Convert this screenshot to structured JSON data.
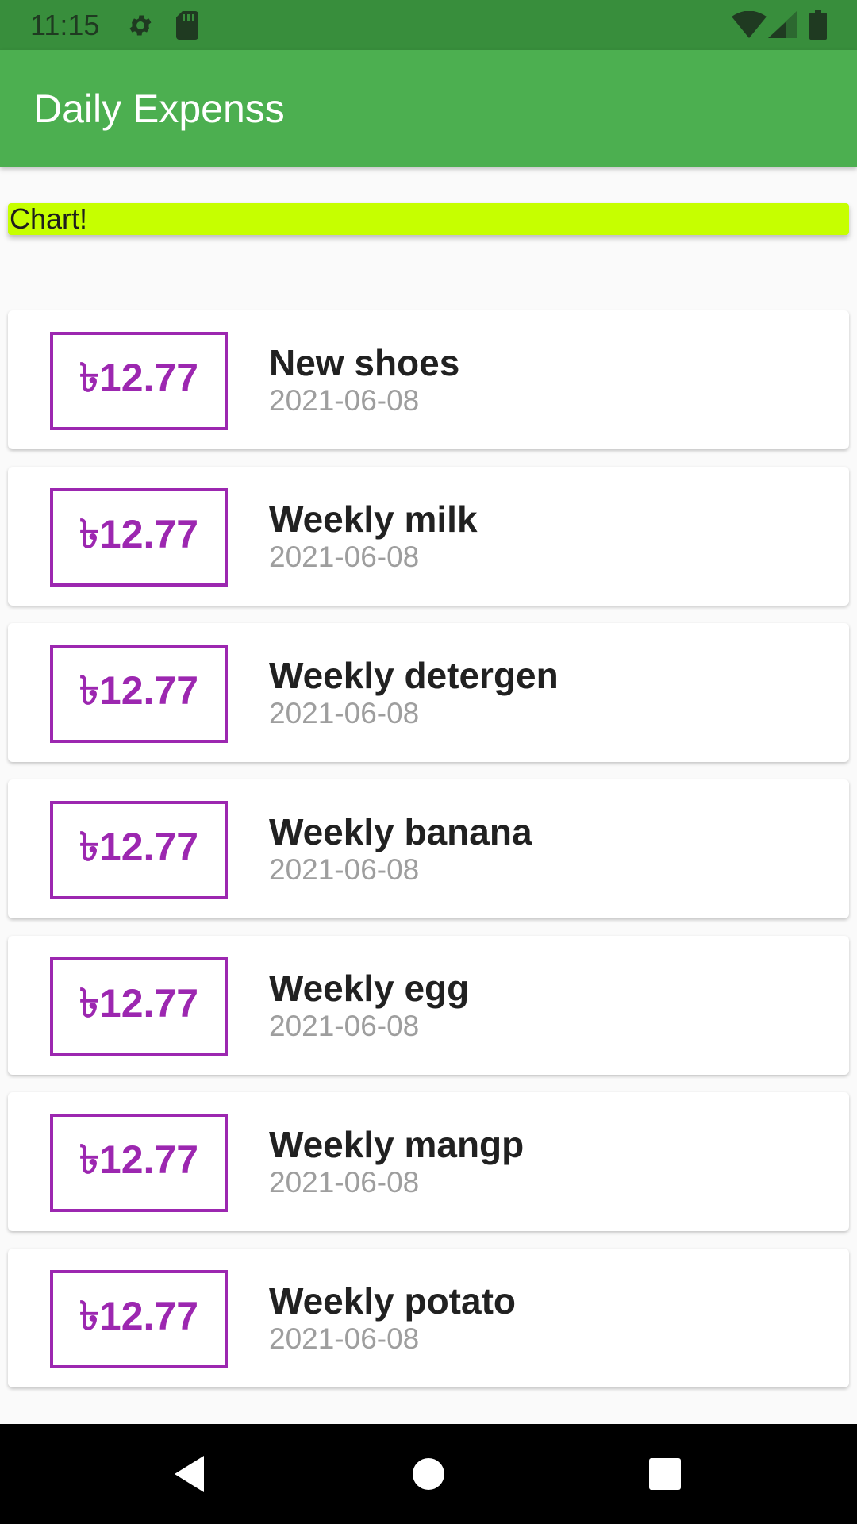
{
  "status_bar": {
    "time": "11:15",
    "icons": [
      "gear-icon",
      "sd-card-icon",
      "wifi-icon",
      "signal-icon",
      "battery-icon"
    ]
  },
  "app_bar": {
    "title": "Daily Expenss",
    "color": "#4caf50"
  },
  "chart": {
    "label": "Chart!",
    "color": "#c6ff00"
  },
  "transactions": [
    {
      "amount": "৳12.77",
      "title": "New shoes",
      "date": "2021-06-08"
    },
    {
      "amount": "৳12.77",
      "title": "Weekly milk",
      "date": "2021-06-08"
    },
    {
      "amount": "৳12.77",
      "title": "Weekly detergen",
      "date": "2021-06-08"
    },
    {
      "amount": "৳12.77",
      "title": "Weekly banana",
      "date": "2021-06-08"
    },
    {
      "amount": "৳12.77",
      "title": "Weekly egg",
      "date": "2021-06-08"
    },
    {
      "amount": "৳12.77",
      "title": "Weekly mangp",
      "date": "2021-06-08"
    },
    {
      "amount": "৳12.77",
      "title": "Weekly potato",
      "date": "2021-06-08"
    }
  ],
  "colors": {
    "accent": "#9c27b0",
    "status_bar": "#388e3c"
  },
  "nav_bar": {
    "buttons": [
      "back-icon",
      "home-icon",
      "recents-icon"
    ]
  }
}
